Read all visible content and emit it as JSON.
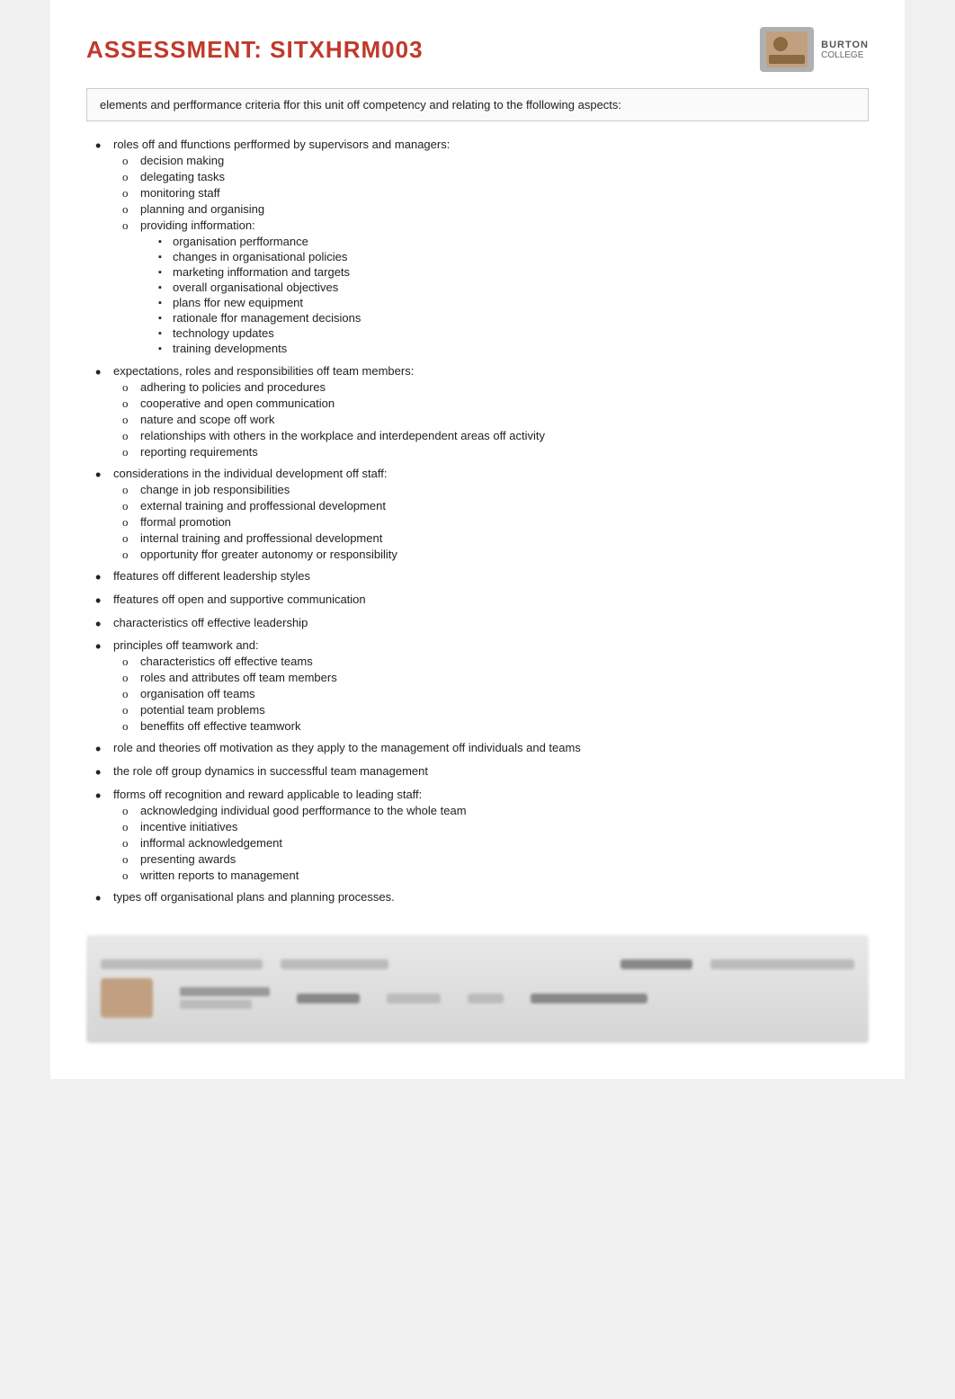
{
  "header": {
    "title": "ASSESSMENT: SITXHRM003",
    "logo_alt": "Institution Logo"
  },
  "intro": {
    "text": "elements and perfformance criteria ffor this unit off competency and relating to the ffollowing aspects:"
  },
  "main_list": [
    {
      "id": "item-roles",
      "text": "roles off and ffunctions perfformed by supervisors and managers:",
      "sub_o": [
        "decision making",
        "delegating tasks",
        "monitoring staff",
        "planning and organising",
        "providing infformation:"
      ],
      "sub_sq": [
        "organisation perfformance",
        "changes in organisational policies",
        "marketing infformation and targets",
        "overall organisational objectives",
        "plans ffor new equipment",
        "rationale ffor management decisions",
        "technology updates",
        "training developments"
      ]
    },
    {
      "id": "item-expectations",
      "text": "expectations, roles and responsibilities off team members:",
      "sub_o": [
        "adhering to policies and procedures",
        "cooperative and open communication",
        "nature and scope off work",
        "relationships with others in the workplace and interdependent areas off activity",
        "reporting requirements"
      ]
    },
    {
      "id": "item-considerations",
      "text": "considerations in the individual development off staff:",
      "sub_o": [
        "change in job responsibilities",
        "external training and proffessional development",
        "fformal promotion",
        "internal training and proffessional development",
        "opportunity ffor greater autonomy or responsibility"
      ]
    },
    {
      "id": "item-leadership",
      "text": "ffeatures off different leadership styles"
    },
    {
      "id": "item-open-communication",
      "text": "ffeatures off open and supportive communication"
    },
    {
      "id": "item-leadership-chars",
      "text": "characteristics off effective leadership"
    },
    {
      "id": "item-teamwork",
      "text": "principles off teamwork and:",
      "sub_o": [
        "characteristics off effective teams",
        "roles and attributes off team members",
        "organisation off teams",
        "potential team problems",
        "beneffits off effective teamwork"
      ]
    },
    {
      "id": "item-motivation",
      "text": "role and theories off motivation as they apply to the management off individuals and teams"
    },
    {
      "id": "item-group-dynamics",
      "text": "the role off group dynamics in successfful team management"
    },
    {
      "id": "item-recognition",
      "text": "fforms off recognition and reward applicable to leading staff:",
      "sub_o": [
        "acknowledging individual good perfformance to the whole team",
        "incentive initiatives",
        "infformal acknowledgement",
        "presenting awards",
        "written reports to management"
      ]
    },
    {
      "id": "item-org-plans",
      "text": "types off organisational plans and planning processes."
    }
  ]
}
